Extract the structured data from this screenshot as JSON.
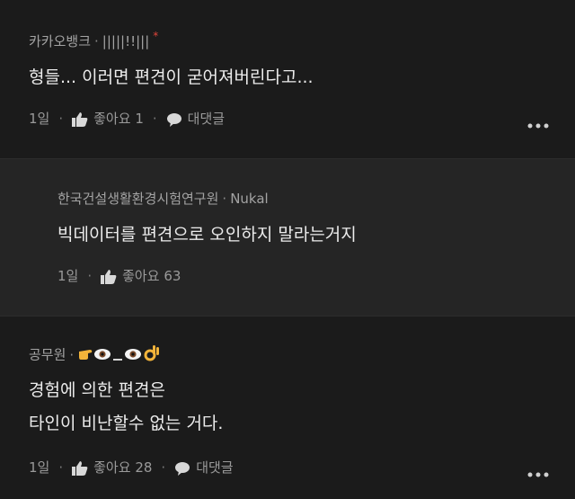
{
  "comments": [
    {
      "author": "카카오뱅크",
      "handle": "|||||!!|||",
      "body": [
        "형들... 이러면 편견이 굳어져버린다고..."
      ],
      "time": "1일",
      "like_label": "좋아요",
      "like_count": "1",
      "reply_label": "대댓글"
    },
    {
      "author": "한국건설생활환경시험연구원",
      "handle": "Nukal",
      "body": [
        "빅데이터를 편견으로 오인하지 말라는거지"
      ],
      "time": "1일",
      "like_label": "좋아요",
      "like_count": "63"
    },
    {
      "author": "공무원",
      "handle_emoji": "👉👁_👁👌",
      "body": [
        "경험에 의한 편견은",
        "타인이 비난할수 없는 거다."
      ],
      "time": "1일",
      "like_label": "좋아요",
      "like_count": "28",
      "reply_label": "대댓글"
    }
  ],
  "separator": "·",
  "colors": {
    "background": "#1b1b1b",
    "reply_background": "#252525",
    "badge": "#e0453a"
  }
}
